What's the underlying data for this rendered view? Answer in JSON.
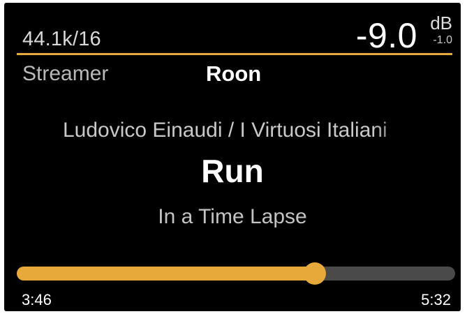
{
  "header": {
    "format": "44.1k/16",
    "volume": "-9.0",
    "volume_unit": "dB",
    "volume_offset": "-1.0"
  },
  "source": {
    "label": "Streamer",
    "value": "Roon"
  },
  "track": {
    "artist": "Ludovico Einaudi / I Virtuosi Italiani",
    "title": "Run",
    "album": "In a Time Lapse"
  },
  "playback": {
    "elapsed": "3:46",
    "duration": "5:32",
    "progress": 0.68
  },
  "colors": {
    "accent": "#e6a93a",
    "background": "#000000",
    "track": "#4a4a4a"
  }
}
